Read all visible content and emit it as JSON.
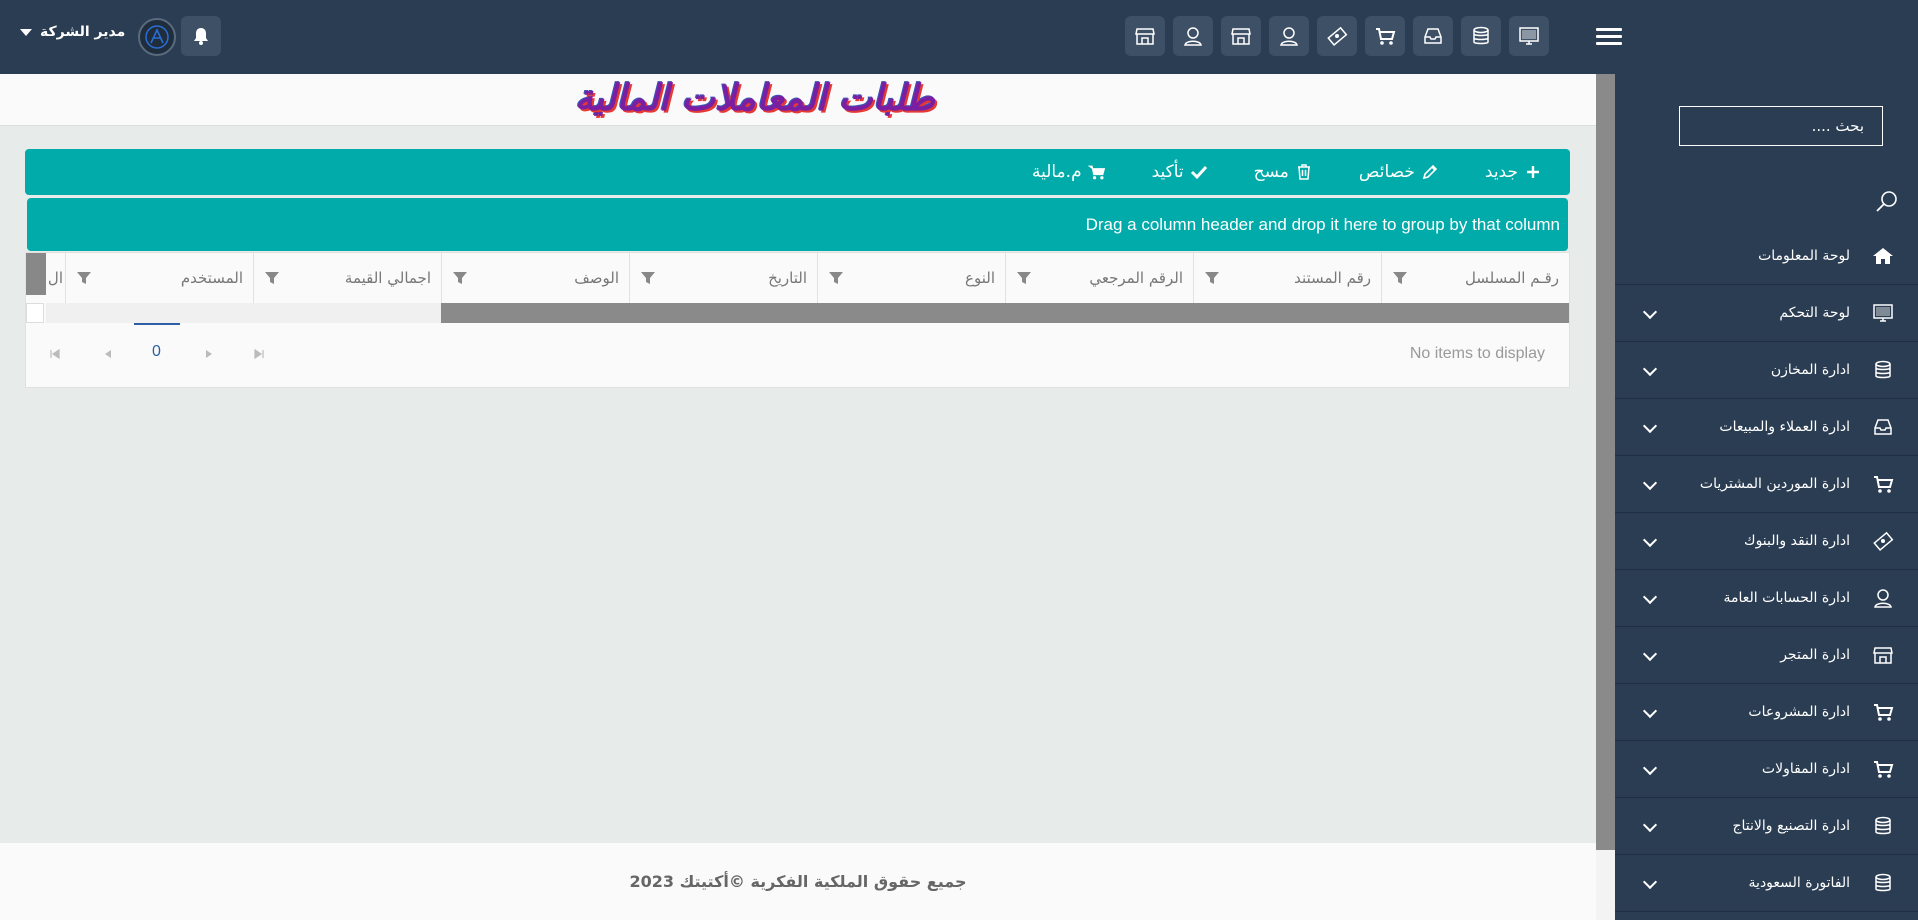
{
  "topbar": {
    "user_name": "مدير الشركة",
    "icons": [
      "shop-icon",
      "user-icon",
      "shop-icon",
      "user-icon",
      "money-bill-icon",
      "cart-icon",
      "inbox-icon",
      "database-icon",
      "monitor-icon"
    ]
  },
  "sidebar": {
    "search_placeholder": "بحث ....",
    "items": [
      {
        "label": "لوحة المعلومات",
        "icon": "home-icon",
        "has_children": false
      },
      {
        "label": "لوحة التحكم",
        "icon": "monitor-icon",
        "has_children": true
      },
      {
        "label": "ادارة المخازن",
        "icon": "database-icon",
        "has_children": true
      },
      {
        "label": "ادارة العملاء والمبيعات",
        "icon": "inbox-icon",
        "has_children": true
      },
      {
        "label": "ادارة الموردين المشتريات",
        "icon": "cart-icon",
        "has_children": true
      },
      {
        "label": "ادارة النقد والبنوك",
        "icon": "money-bill-icon",
        "has_children": true
      },
      {
        "label": "ادارة الحسابات العامة",
        "icon": "user-icon",
        "has_children": true
      },
      {
        "label": "ادارة المتجر",
        "icon": "shop-icon",
        "has_children": true
      },
      {
        "label": "ادارة المشروعات",
        "icon": "cart-icon",
        "has_children": true
      },
      {
        "label": "ادارة المقاولات",
        "icon": "cart-icon",
        "has_children": true
      },
      {
        "label": "ادارة التصنيع والانتاج",
        "icon": "database-icon",
        "has_children": true
      },
      {
        "label": "الفاتورة السعودية",
        "icon": "database-icon",
        "has_children": true
      }
    ]
  },
  "page": {
    "title": "طلبات المعاملات المالية"
  },
  "toolbar": {
    "new_label": "جديد",
    "edit_label": "خصائص",
    "delete_label": "مسح",
    "confirm_label": "تأكيد",
    "financial_label": "م.مالية"
  },
  "grid": {
    "group_hint": "Drag a column header and drop it here to group by that column",
    "columns": [
      "رقـم المسلسل",
      "رقم المستند",
      "الرقم المرجعي",
      "النوع",
      "التاريخ",
      "الوصف",
      "اجمالي القيمة",
      "المستخدم",
      "ال"
    ],
    "empty_text": "No items to display",
    "page_number": "0"
  },
  "footer": {
    "copyright": "جميع حقوق الملكية الفكرية ©أكتيتك 2023"
  }
}
